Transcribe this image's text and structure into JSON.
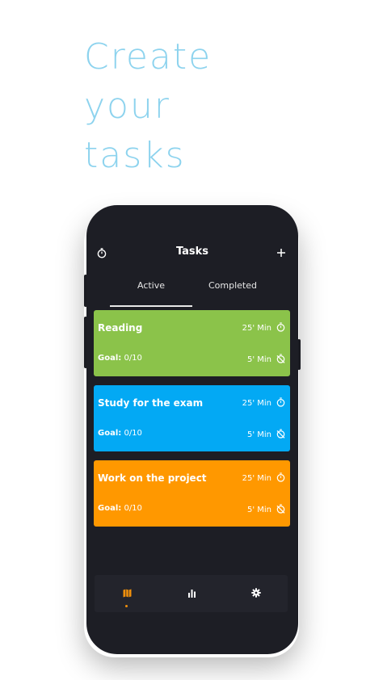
{
  "headline": {
    "line1": "Create",
    "line2": "your",
    "line3": "tasks",
    "color": "#8dd3ee"
  },
  "app": {
    "title": "Tasks",
    "timer_icon": "stopwatch-icon",
    "add_icon": "plus-icon",
    "background": "#1d1e25"
  },
  "tabs": [
    {
      "label": "Active",
      "selected": true
    },
    {
      "label": "Completed",
      "selected": false
    }
  ],
  "tasks": [
    {
      "title": "Reading",
      "goal_label": "Goal:",
      "goal_value": "0/10",
      "work": "25' Min",
      "break": "5' Min",
      "color": "#8bc34a"
    },
    {
      "title": "Study for the exam",
      "goal_label": "Goal:",
      "goal_value": "0/10",
      "work": "25' Min",
      "break": "5' Min",
      "color": "#03a9f4"
    },
    {
      "title": "Work on the project",
      "goal_label": "Goal:",
      "goal_value": "0/10",
      "work": "25' Min",
      "break": "5' Min",
      "color": "#ff9800"
    }
  ],
  "bottom_nav": [
    {
      "icon": "map-icon",
      "active": true
    },
    {
      "icon": "bar-chart-icon",
      "active": false
    },
    {
      "icon": "gear-icon",
      "active": false
    }
  ],
  "accent": "#f0900c"
}
